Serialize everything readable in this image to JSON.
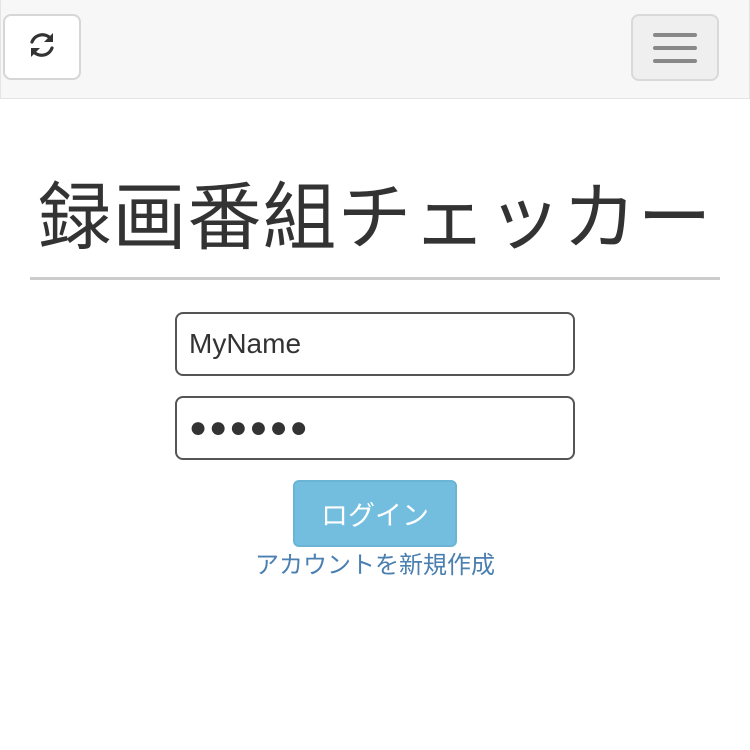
{
  "navbar": {
    "reload_icon": "refresh-icon",
    "menu_icon": "hamburger-menu-icon"
  },
  "page": {
    "title": "録画番組チェッカー"
  },
  "login_form": {
    "username_value": "MyName",
    "password_value": "●●●●●●",
    "login_label": "ログイン",
    "signup_link_label": "アカウントを新規作成"
  },
  "colors": {
    "login_button": "#73bedf",
    "link": "#4a7fb0",
    "navbar_bg": "#f7f7f7"
  }
}
